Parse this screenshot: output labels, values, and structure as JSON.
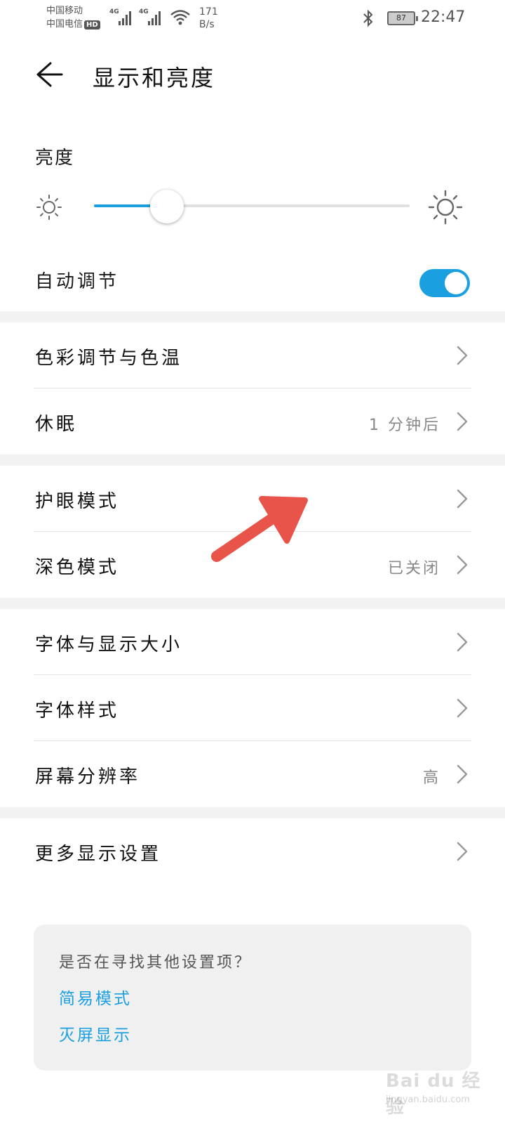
{
  "status_bar": {
    "carrier_1": "中国移动",
    "carrier_2": "中国电信",
    "hd_badge": "HD",
    "signal_1_tag": "4G",
    "signal_2_tag": "4G",
    "net_speed_value": "171",
    "net_speed_unit": "B/s",
    "battery": "87",
    "time": "22:47"
  },
  "header": {
    "title": "显示和亮度"
  },
  "brightness": {
    "label": "亮度",
    "level": 0.23,
    "auto_label": "自动调节",
    "auto_on": true,
    "accent_color": "#1a9fe0"
  },
  "groups": [
    {
      "rows": [
        {
          "name": "color-temperature",
          "label": "色彩调节与色温",
          "value": ""
        },
        {
          "name": "sleep",
          "label": "休眠",
          "value": "1 分钟后"
        }
      ]
    },
    {
      "rows": [
        {
          "name": "eye-comfort",
          "label": "护眼模式",
          "value": ""
        },
        {
          "name": "dark-mode",
          "label": "深色模式",
          "value": "已关闭"
        }
      ]
    },
    {
      "rows": [
        {
          "name": "font-display-size",
          "label": "字体与显示大小",
          "value": ""
        },
        {
          "name": "font-style",
          "label": "字体样式",
          "value": ""
        },
        {
          "name": "screen-resolution",
          "label": "屏幕分辨率",
          "value": "高"
        }
      ]
    },
    {
      "rows": [
        {
          "name": "more-display-settings",
          "label": "更多显示设置",
          "value": ""
        }
      ]
    }
  ],
  "suggest": {
    "question": "是否在寻找其他设置项？",
    "link_1": "简易模式",
    "link_2": "灭屏显示"
  },
  "annotation": {
    "arrow_color": "#e8534a"
  },
  "watermark": {
    "main": "Bai du 经验",
    "sub": "jingyan.baidu.com"
  }
}
